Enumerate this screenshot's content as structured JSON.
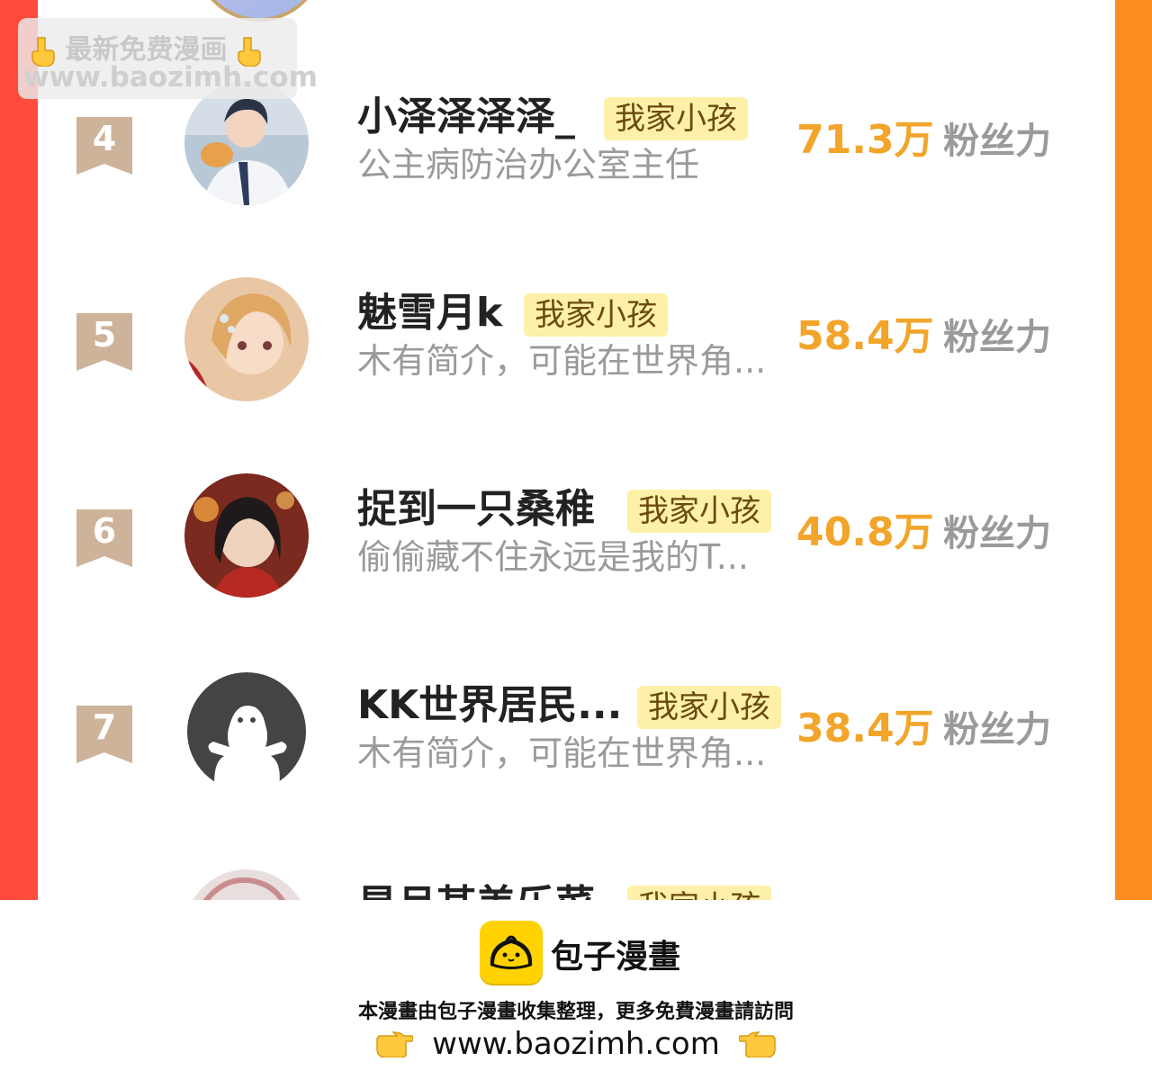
{
  "watermark": {
    "line1": "最新免费漫画",
    "line2": "www.baozimh.com",
    "icon": "pointing-down-hand-icon"
  },
  "ranking": [
    {
      "rank": "4",
      "name": "小泽泽泽泽_",
      "badge": "我家小孩",
      "bio": "公主病防治办公室主任",
      "fans": "71.3万",
      "fans_label": "粉丝力",
      "avatar": "boy-with-fox-avatar"
    },
    {
      "rank": "5",
      "name": "魅雪月k",
      "badge": "我家小孩",
      "bio": "木有简介，可能在世界角...",
      "fans": "58.4万",
      "fans_label": "粉丝力",
      "avatar": "blonde-girl-avatar"
    },
    {
      "rank": "6",
      "name": "捉到一只桑稚",
      "badge": "我家小孩",
      "bio": "偷偷藏不住永远是我的T...",
      "fans": "40.8万",
      "fans_label": "粉丝力",
      "avatar": "dark-hair-boy-avatar"
    },
    {
      "rank": "7",
      "name": "KK世界居民...",
      "badge": "我家小孩",
      "bio": "木有简介，可能在世界角...",
      "fans": "38.4万",
      "fans_label": "粉丝力",
      "avatar": "default-user-avatar"
    },
    {
      "rank": "",
      "name": "星月某美乐菜",
      "badge": "我家小孩",
      "bio": "",
      "fans": "",
      "fans_label": "",
      "avatar": "partial-avatar"
    }
  ],
  "colors": {
    "frame_gradient_start": "#ff4a3d",
    "frame_gradient_end": "#ff8e20",
    "fans_color": "#f2a52a",
    "badge_bg": "#fdf0a8",
    "rank_ribbon": "#cdb39a"
  },
  "footer": {
    "brand_name": "包子漫畫",
    "brand_icon": "baozi-bun-logo-icon",
    "note": "本漫畫由包子漫畫收集整理，更多免費漫畫請訪問",
    "url": "www.baozimh.com",
    "left_icon": "pointing-right-hand-icon",
    "right_icon": "pointing-left-hand-icon"
  }
}
